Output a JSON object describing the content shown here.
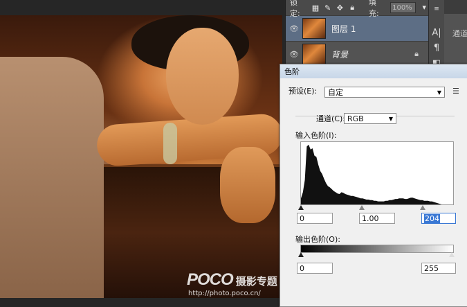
{
  "layers_panel": {
    "lock_label": "锁定:",
    "fill_label": "填充:",
    "fill_value": "100%",
    "layers": [
      {
        "name": "图层 1",
        "selected": true,
        "italic": false,
        "locked": false
      },
      {
        "name": "背景",
        "selected": false,
        "italic": true,
        "locked": true
      }
    ]
  },
  "side_panel": {
    "tab_label": "通道"
  },
  "levels_dialog": {
    "title": "色阶",
    "preset_label": "预设(E):",
    "preset_value": "自定",
    "channel_label": "通道(C):",
    "channel_value": "RGB",
    "input_levels_label": "输入色阶(I):",
    "input_black": "0",
    "input_gamma": "1.00",
    "input_white": "204",
    "output_levels_label": "输出色阶(O):",
    "output_black": "0",
    "output_white": "255"
  },
  "histogram": [
    0.1,
    0.2,
    0.4,
    0.95,
    0.98,
    0.9,
    0.92,
    0.8,
    0.78,
    0.65,
    0.55,
    0.5,
    0.42,
    0.35,
    0.3,
    0.28,
    0.25,
    0.22,
    0.2,
    0.18,
    0.17,
    0.2,
    0.19,
    0.17,
    0.16,
    0.15,
    0.14,
    0.14,
    0.13,
    0.12,
    0.11,
    0.1,
    0.1,
    0.09,
    0.08,
    0.08,
    0.07,
    0.07,
    0.06,
    0.06,
    0.05,
    0.05,
    0.05,
    0.05,
    0.06,
    0.06,
    0.07,
    0.07,
    0.08,
    0.09,
    0.09,
    0.1,
    0.1,
    0.1,
    0.09,
    0.09,
    0.1,
    0.11,
    0.11,
    0.1,
    0.09,
    0.08,
    0.07,
    0.07,
    0.06,
    0.06,
    0.06,
    0.05,
    0.05,
    0.04,
    0.03,
    0.02,
    0.01,
    0.0,
    0.0,
    0.0,
    0.0,
    0.0,
    0.0,
    0.0
  ],
  "watermark": {
    "logo": "POCO",
    "title": "摄影专题",
    "url": "http://photo.poco.cn/"
  }
}
